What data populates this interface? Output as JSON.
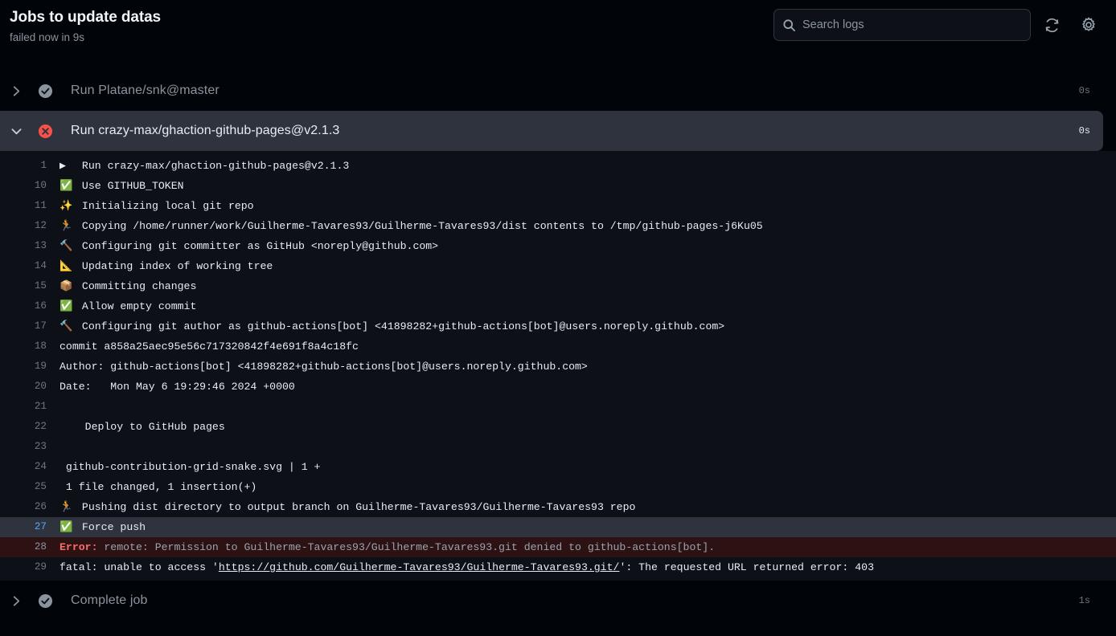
{
  "header": {
    "title": "Jobs to update datas",
    "subtitle": "failed now in 9s",
    "search": {
      "placeholder": "Search logs",
      "value": ""
    },
    "refresh_icon": "refresh-icon",
    "settings_icon": "gear-icon"
  },
  "steps": [
    {
      "label": "Run Platane/snk@master",
      "status": "success-neutral",
      "status_icon": "check-circle-icon",
      "expanded": false,
      "chevron": "chevron-right-icon",
      "duration": "0s",
      "selected": false
    },
    {
      "label": "Run crazy-max/ghaction-github-pages@v2.1.3",
      "status": "failed",
      "status_icon": "x-circle-icon",
      "expanded": true,
      "chevron": "chevron-down-icon",
      "duration": "0s",
      "selected": true
    },
    {
      "label": "Complete job",
      "status": "success-neutral",
      "status_icon": "check-circle-icon",
      "expanded": false,
      "chevron": "chevron-right-icon",
      "duration": "1s",
      "selected": false
    }
  ],
  "log": {
    "lines": [
      {
        "n": "1",
        "emoji": "▶",
        "emoji_name": "play-triangle-icon",
        "text": "Run crazy-max/ghaction-github-pages@v2.1.3"
      },
      {
        "n": "10",
        "emoji": "✅",
        "emoji_name": "white-check-mark-emoji",
        "text": "Use GITHUB_TOKEN"
      },
      {
        "n": "11",
        "emoji": "✨",
        "emoji_name": "sparkles-emoji",
        "text": "Initializing local git repo"
      },
      {
        "n": "12",
        "emoji": "🏃",
        "emoji_name": "runner-emoji",
        "text": "Copying /home/runner/work/Guilherme-Tavares93/Guilherme-Tavares93/dist contents to /tmp/github-pages-j6Ku05"
      },
      {
        "n": "13",
        "emoji": "🔨",
        "emoji_name": "hammer-emoji",
        "text": "Configuring git committer as GitHub <noreply@github.com>"
      },
      {
        "n": "14",
        "emoji": "📐",
        "emoji_name": "triangular-ruler-emoji",
        "text": "Updating index of working tree"
      },
      {
        "n": "15",
        "emoji": "📦",
        "emoji_name": "package-emoji",
        "text": "Committing changes"
      },
      {
        "n": "16",
        "emoji": "✅",
        "emoji_name": "white-check-mark-emoji",
        "text": "Allow empty commit"
      },
      {
        "n": "17",
        "emoji": "🔨",
        "emoji_name": "hammer-emoji",
        "text": "Configuring git author as github-actions[bot] <41898282+github-actions[bot]@users.noreply.github.com>"
      },
      {
        "n": "18",
        "emoji": "",
        "emoji_name": "",
        "text": "commit a858a25aec95e56c717320842f4e691f8a4c18fc"
      },
      {
        "n": "19",
        "emoji": "",
        "emoji_name": "",
        "text": "Author: github-actions[bot] <41898282+github-actions[bot]@users.noreply.github.com>"
      },
      {
        "n": "20",
        "emoji": "",
        "emoji_name": "",
        "text": "Date:   Mon May 6 19:29:46 2024 +0000"
      },
      {
        "n": "21",
        "emoji": "",
        "emoji_name": "",
        "text": ""
      },
      {
        "n": "22",
        "emoji": "",
        "emoji_name": "",
        "text": "    Deploy to GitHub pages"
      },
      {
        "n": "23",
        "emoji": "",
        "emoji_name": "",
        "text": ""
      },
      {
        "n": "24",
        "emoji": "",
        "emoji_name": "",
        "text": " github-contribution-grid-snake.svg | 1 +"
      },
      {
        "n": "25",
        "emoji": "",
        "emoji_name": "",
        "text": " 1 file changed, 1 insertion(+)"
      },
      {
        "n": "26",
        "emoji": "🏃",
        "emoji_name": "runner-emoji",
        "text": "Pushing dist directory to output branch on Guilherme-Tavares93/Guilherme-Tavares93 repo"
      },
      {
        "n": "27",
        "emoji": "✅",
        "emoji_name": "white-check-mark-emoji",
        "text": "Force push",
        "highlight": true
      },
      {
        "n": "28",
        "emoji": "",
        "emoji_name": "",
        "error": true,
        "error_label": "Error:",
        "error_text": " remote: Permission to Guilherme-Tavares93/Guilherme-Tavares93.git denied to github-actions[bot]."
      },
      {
        "n": "29",
        "emoji": "",
        "emoji_name": "",
        "pre_link": "fatal: unable to access '",
        "link": "https://github.com/Guilherme-Tavares93/Guilherme-Tavares93.git/",
        "post_link": "': The requested URL returned error: 403"
      }
    ]
  },
  "colors": {
    "page_bg": "#010409",
    "log_bg": "#0d1117",
    "selected_bg": "#2f333d",
    "error_bg": "#2d1214",
    "error_red": "#ff6a69",
    "fail_icon": "#f85149",
    "neutral_icon": "#8b949e",
    "link_blue": "#58a6ff",
    "text": "#e6edf3",
    "muted": "#8b949e"
  }
}
